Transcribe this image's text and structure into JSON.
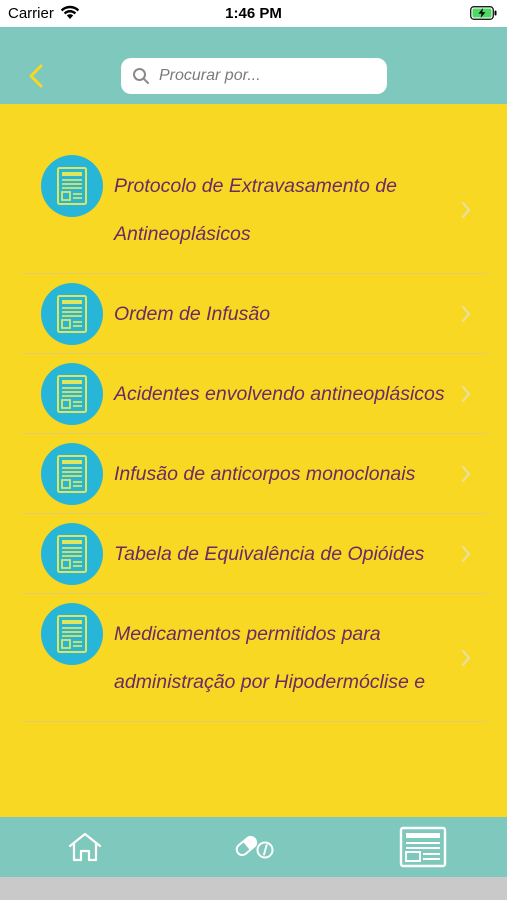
{
  "status_bar": {
    "carrier": "Carrier",
    "time": "1:46 PM"
  },
  "nav": {
    "back_icon": "chevron-left-icon",
    "search": {
      "placeholder": "Procurar por...",
      "value": ""
    }
  },
  "colors": {
    "nav_background": "#7ec8bd",
    "list_background": "#f8d822",
    "item_text": "#6a2a66",
    "icon_circle": "#27b6d8",
    "back_chevron": "#f8d822"
  },
  "list": {
    "items": [
      {
        "icon": "document-icon",
        "label": "Protocolo de Extravasamento de Antineoplásicos"
      },
      {
        "icon": "document-icon",
        "label": "Ordem de Infusão"
      },
      {
        "icon": "document-icon",
        "label": "Acidentes envolvendo antineoplásicos"
      },
      {
        "icon": "document-icon",
        "label": "Infusão de anticorpos monoclonais"
      },
      {
        "icon": "document-icon",
        "label": "Tabela de Equivalência de Opióides"
      },
      {
        "icon": "document-icon",
        "label": "Medicamentos permitidos para administração por Hipodermóclise e"
      }
    ]
  },
  "tab_bar": {
    "tabs": [
      {
        "icon": "home-icon",
        "selected": false
      },
      {
        "icon": "pills-info-icon",
        "selected": false
      },
      {
        "icon": "protocol-document-icon",
        "selected": true
      }
    ]
  }
}
